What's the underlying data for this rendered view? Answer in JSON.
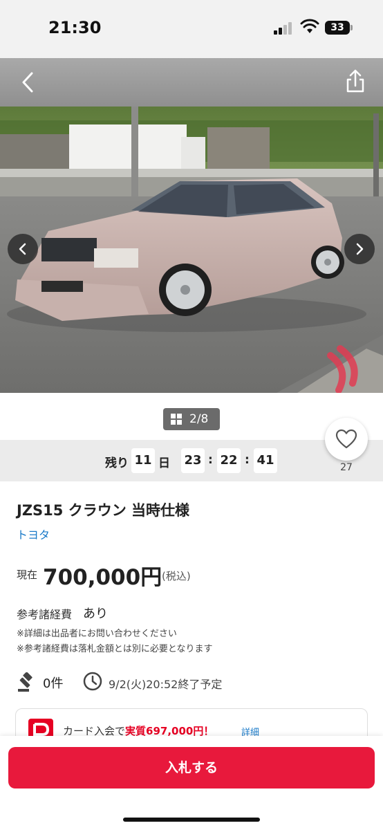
{
  "status_bar": {
    "time": "21:30",
    "battery": "33"
  },
  "gallery": {
    "counter": "2/8"
  },
  "countdown": {
    "label": "残り",
    "days": "11",
    "days_unit": "日",
    "hours": "23",
    "minutes": "22",
    "seconds": "41",
    "separator": ":"
  },
  "favorites": {
    "count": "27"
  },
  "listing": {
    "title": "JZS15 クラウン 当時仕様",
    "brand": "トヨタ",
    "price_label": "現在",
    "price": "700,000円",
    "price_tax": "(税込)",
    "fee_label": "参考諸経費",
    "fee_value": "あり",
    "notes": [
      "※詳細は出品者にお問い合わせください",
      "※参考諸経費は落札金額とは別に必要となります"
    ],
    "bid_count": "0件",
    "end_time": "9/2(火)20:52終了予定"
  },
  "promo": {
    "text_prefix": "カード入会で",
    "text_highlight": "実質697,000円！",
    "detail": "詳細"
  },
  "actions": {
    "bid_button": "入札する"
  },
  "colors": {
    "accent": "#e8193c",
    "link": "#1a7ac8",
    "car_body": "#c9b3ad"
  },
  "icons": [
    "back-icon",
    "share-icon",
    "chevron-left-icon",
    "chevron-right-icon",
    "grid-icon",
    "heart-icon",
    "gavel-icon",
    "clock-icon",
    "paypay-card-icon"
  ]
}
